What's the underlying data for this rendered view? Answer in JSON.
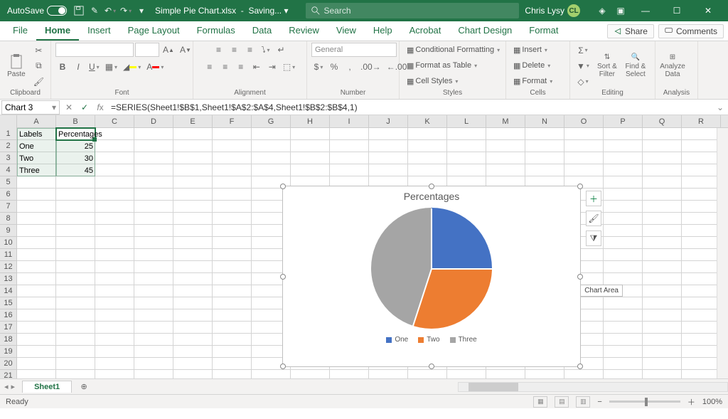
{
  "title_bar": {
    "autosave_label": "AutoSave",
    "autosave_on": "On",
    "doc_name": "Simple Pie Chart.xlsx",
    "saving_text": "Saving...",
    "search_placeholder": "Search",
    "user_name": "Chris Lysy",
    "user_initials": "CL"
  },
  "tabs": [
    "File",
    "Home",
    "Insert",
    "Page Layout",
    "Formulas",
    "Data",
    "Review",
    "View",
    "Help",
    "Acrobat",
    "Chart Design",
    "Format"
  ],
  "active_tab": "Home",
  "ribbon_right": {
    "share": "Share",
    "comments": "Comments"
  },
  "ribbon": {
    "clipboard": {
      "label": "Clipboard",
      "paste": "Paste"
    },
    "font": {
      "label": "Font",
      "number_label": "Number",
      "general": "General"
    },
    "alignment": {
      "label": "Alignment"
    },
    "number": {
      "label": "Number"
    },
    "styles": {
      "label": "Styles",
      "conditional": "Conditional Formatting",
      "as_table": "Format as Table",
      "cell_styles": "Cell Styles"
    },
    "cells": {
      "label": "Cells",
      "insert": "Insert",
      "delete": "Delete",
      "format": "Format"
    },
    "editing": {
      "label": "Editing",
      "sort": "Sort & Filter",
      "find": "Find & Select"
    },
    "analysis": {
      "label": "Analysis",
      "analyze": "Analyze Data"
    }
  },
  "name_box": "Chart 3",
  "formula": "=SERIES(Sheet1!$B$1,Sheet1!$A$2:$A$4,Sheet1!$B$2:$B$4,1)",
  "columns": [
    "A",
    "B",
    "C",
    "D",
    "E",
    "F",
    "G",
    "H",
    "I",
    "J",
    "K",
    "L",
    "M",
    "N",
    "O",
    "P",
    "Q",
    "R"
  ],
  "rows": 22,
  "cells": {
    "A1": "Labels",
    "B1": "Percentages",
    "A2": "One",
    "B2": "25",
    "A3": "Two",
    "B3": "30",
    "A4": "Three",
    "B4": "45"
  },
  "chart_data": {
    "type": "pie",
    "title": "Percentages",
    "categories": [
      "One",
      "Two",
      "Three"
    ],
    "values": [
      25,
      30,
      45
    ],
    "colors": [
      "#4472c4",
      "#ed7d31",
      "#a5a5a5"
    ],
    "legend_position": "bottom",
    "tooltip": "Chart Area"
  },
  "sheet_bar": {
    "sheet": "Sheet1"
  },
  "status_bar": {
    "ready": "Ready",
    "zoom": "100%"
  }
}
